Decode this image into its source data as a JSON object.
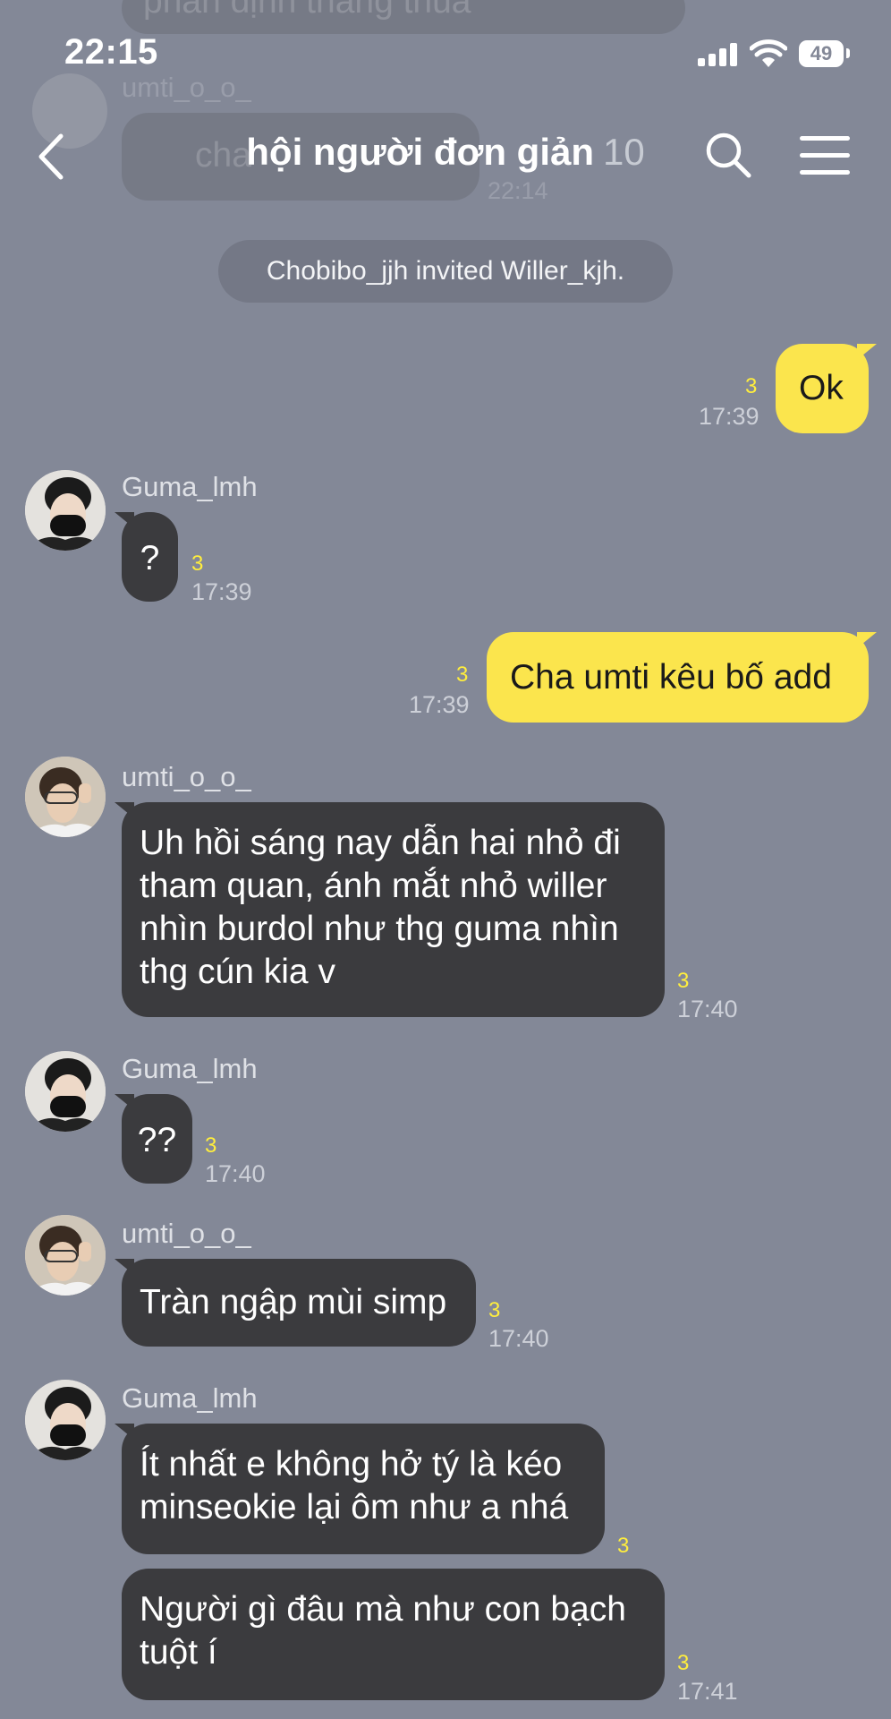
{
  "status_bar": {
    "time": "22:15",
    "battery": "49"
  },
  "ghost": {
    "top_text": "phân định thắng thua",
    "sender": "umti_o_o_",
    "bubble_text": "cha",
    "time": "22:14"
  },
  "header": {
    "title": "hội người đơn giản",
    "member_count": "10"
  },
  "notice": "Chobibo_jjh invited Willer_kjh.",
  "messages": [
    {
      "side": "me",
      "text": "Ok",
      "unread": "3",
      "time": "17:39"
    },
    {
      "side": "other",
      "sender": "Guma_lmh",
      "text": "?",
      "unread": "3",
      "time": "17:39"
    },
    {
      "side": "me",
      "text": "Cha umti kêu bố add",
      "unread": "3",
      "time": "17:39"
    },
    {
      "side": "other",
      "sender": "umti_o_o_",
      "lines": [
        "Uh hồi sáng nay dẫn hai nhỏ đi",
        "tham quan, ánh mắt nhỏ willer",
        "nhìn burdol như thg guma nhìn",
        "thg cún kia v"
      ],
      "unread": "3",
      "time": "17:40"
    },
    {
      "side": "other",
      "sender": "Guma_lmh",
      "text": "??",
      "unread": "3",
      "time": "17:40"
    },
    {
      "side": "other",
      "sender": "umti_o_o_",
      "text": "Tràn ngập mùi simp",
      "unread": "3",
      "time": "17:40"
    },
    {
      "side": "other",
      "sender": "Guma_lmh",
      "lines": [
        "Ít nhất e không hở tý là kéo",
        "minseokie lại ôm như a nhá"
      ],
      "unread": "3"
    },
    {
      "side": "other",
      "lines": [
        "Người gì đâu mà như con bạch",
        "tuột í"
      ],
      "unread": "3",
      "time": "17:41"
    }
  ],
  "colors": {
    "background": "#838897",
    "bubble_dark": "#3b3b3e",
    "bubble_me": "#fbe54d",
    "unread": "#ffee3d"
  }
}
